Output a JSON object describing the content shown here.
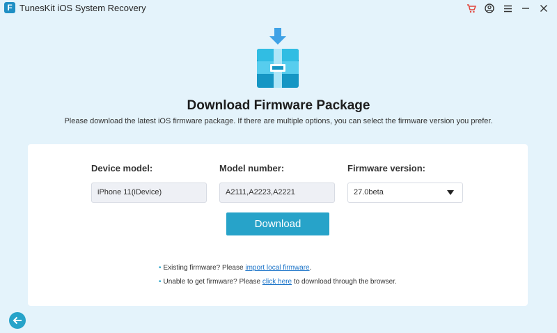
{
  "app": {
    "title": "TunesKit iOS System Recovery",
    "logo_letter": "F"
  },
  "titlebar": {
    "icons": [
      "cart-icon",
      "account-icon",
      "menu-icon",
      "minimize-icon",
      "close-icon"
    ]
  },
  "page": {
    "heading": "Download Firmware Package",
    "subtext": "Please download the latest iOS firmware package. If there are multiple options, you can select the firmware version you prefer."
  },
  "form": {
    "device_model": {
      "label": "Device model:",
      "value": "iPhone 11(iDevice)"
    },
    "model_number": {
      "label": "Model number:",
      "value": "A2111,A2223,A2221"
    },
    "firmware_version": {
      "label": "Firmware version:",
      "value": "27.0beta"
    },
    "download_label": "Download"
  },
  "notes": {
    "existing": {
      "prefix": "Existing firmware? Please ",
      "link": "import local firmware",
      "suffix": "."
    },
    "unable": {
      "prefix": "Unable to get firmware? Please ",
      "link": "click here",
      "suffix": " to download through the browser."
    },
    "bullet": "•"
  },
  "colors": {
    "accent": "#27a3c9",
    "background": "#e4f3fb",
    "link": "#1a73c8"
  }
}
